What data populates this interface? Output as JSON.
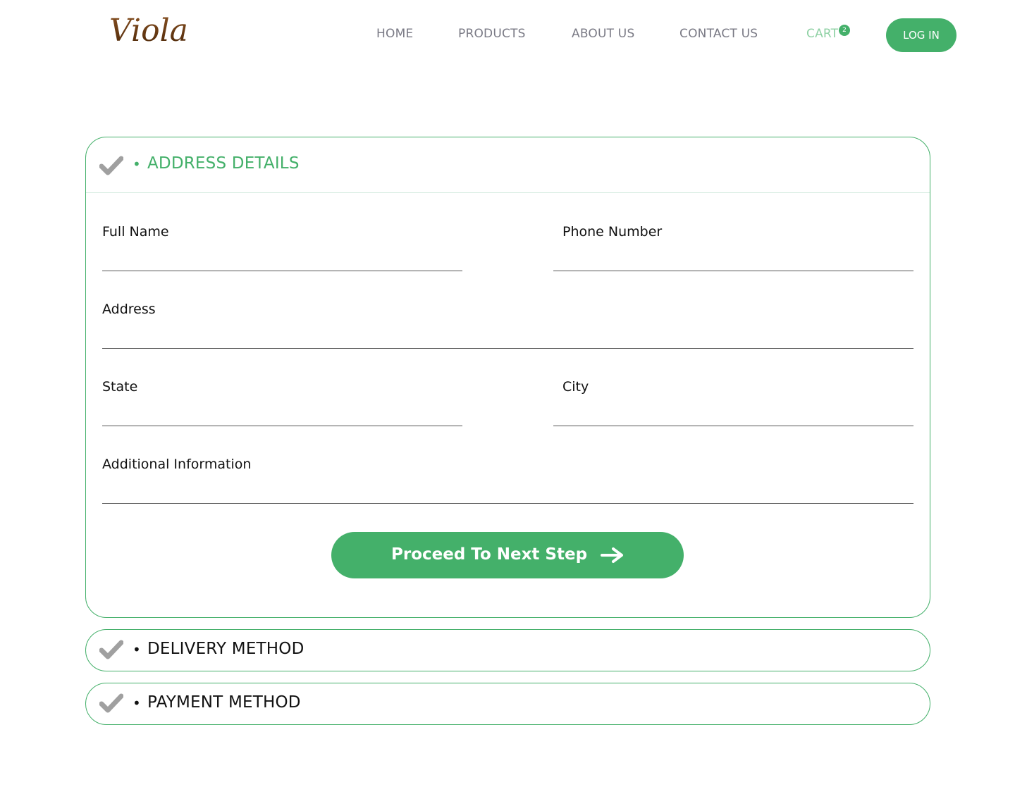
{
  "brand": {
    "logo_text": "Viola"
  },
  "nav": {
    "home": "HOME",
    "products": "PRODUCTS",
    "about": "ABOUT US",
    "contact": "CONTACT US",
    "cart": "CART",
    "cart_count": "2",
    "login": "LOG IN"
  },
  "address_section": {
    "title": "ADDRESS DETAILS",
    "bullet": "•",
    "fields": {
      "full_name": {
        "label": "Full Name",
        "value": ""
      },
      "phone": {
        "label": "Phone Number",
        "value": ""
      },
      "address": {
        "label": "Address",
        "value": ""
      },
      "state": {
        "label": "State",
        "value": ""
      },
      "city": {
        "label": "City",
        "value": ""
      },
      "additional": {
        "label": "Additional Information",
        "value": ""
      }
    },
    "proceed_label": "Proceed To Next Step"
  },
  "delivery_section": {
    "title": "DELIVERY METHOD",
    "bullet": "•"
  },
  "payment_section": {
    "title": "PAYMENT METHOD",
    "bullet": "•"
  },
  "colors": {
    "accent": "#44b06a",
    "nav_text": "#7a7a85",
    "cart_text": "#8fd1a4",
    "check_icon": "#a0a0a0",
    "logo_brown": "#6b3a12"
  },
  "icons": {
    "check": "check-icon",
    "arrow": "arrow-right-icon",
    "logo": "viola-logo"
  }
}
